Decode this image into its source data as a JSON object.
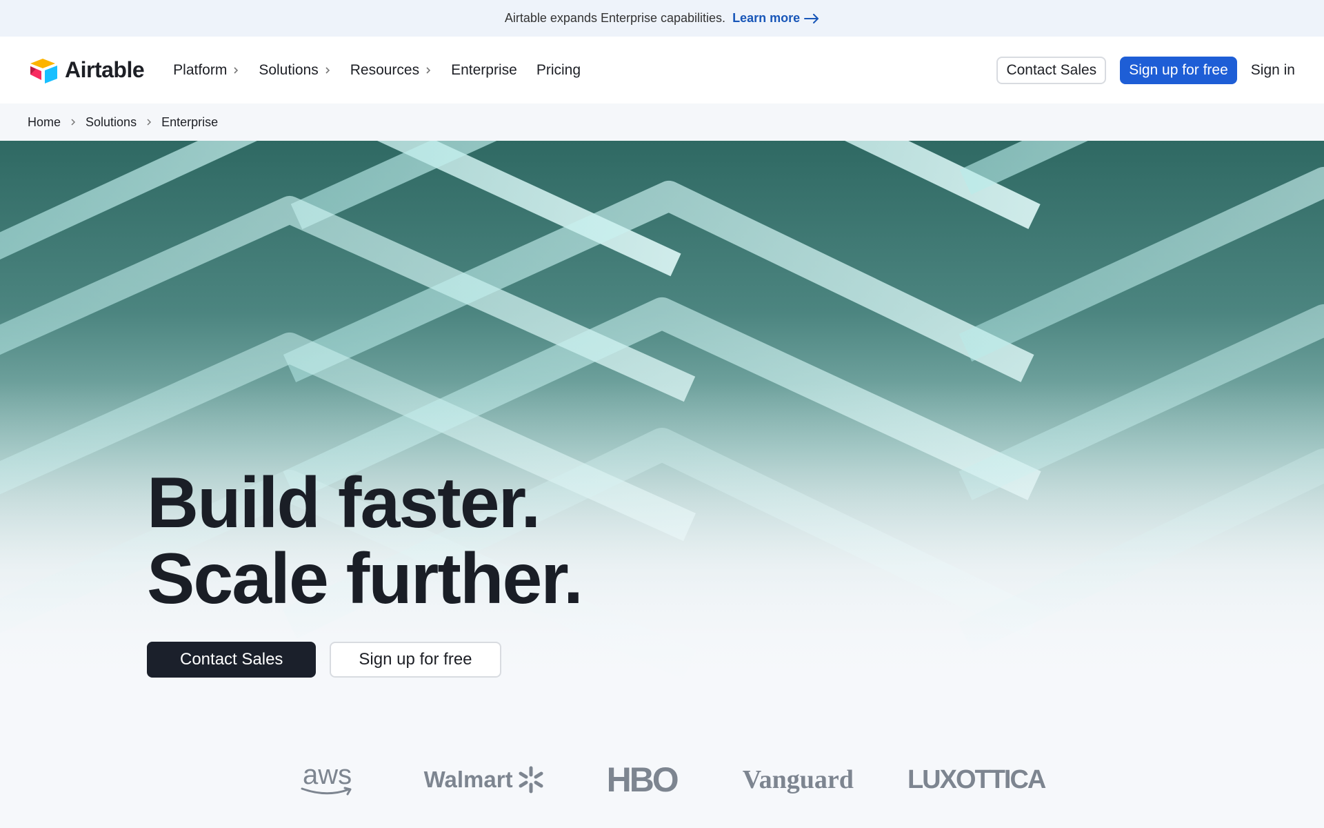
{
  "banner": {
    "text": "Airtable expands Enterprise capabilities.",
    "link_label": "Learn more"
  },
  "header": {
    "brand": "Airtable",
    "nav": [
      {
        "label": "Platform",
        "has_menu": true
      },
      {
        "label": "Solutions",
        "has_menu": true
      },
      {
        "label": "Resources",
        "has_menu": true
      },
      {
        "label": "Enterprise",
        "has_menu": false
      },
      {
        "label": "Pricing",
        "has_menu": false
      }
    ],
    "contact_sales_label": "Contact Sales",
    "signup_label": "Sign up for free",
    "signin_label": "Sign in"
  },
  "breadcrumb": [
    "Home",
    "Solutions",
    "Enterprise"
  ],
  "hero": {
    "title_line1": "Build faster.",
    "title_line2": "Scale further.",
    "primary_cta": "Contact Sales",
    "secondary_cta": "Sign up for free"
  },
  "customer_logos": [
    "aws",
    "Walmart",
    "HBO",
    "Vanguard",
    "LUXOTTICA"
  ],
  "colors": {
    "accent_blue": "#1e5ed6",
    "banner_link": "#1856b8",
    "dark_button": "#1b202b",
    "logo_gray": "#7d8590",
    "hero_teal": "#4c8580"
  }
}
